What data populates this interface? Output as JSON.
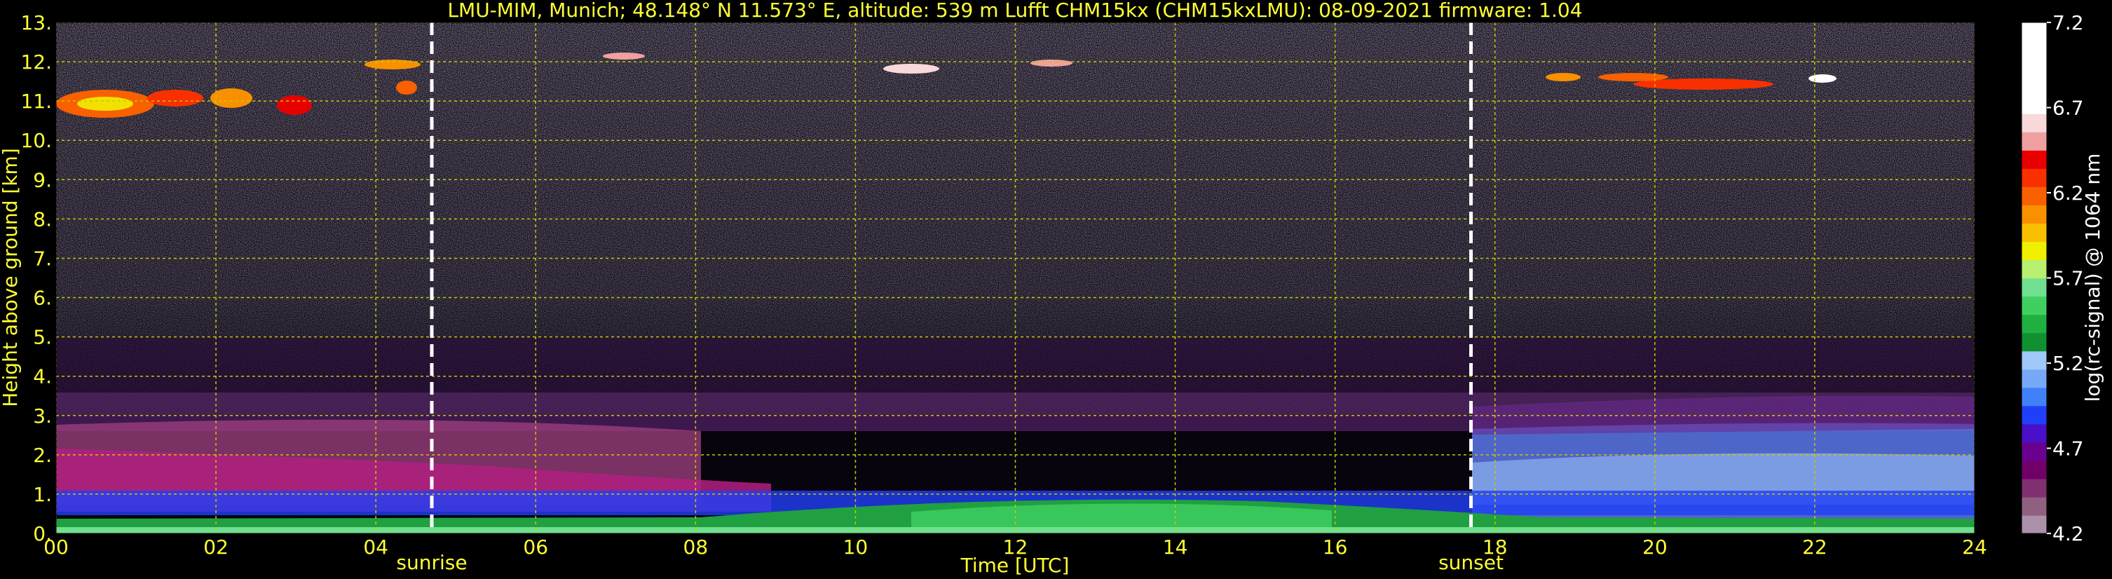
{
  "chart_data": {
    "type": "heatmap",
    "title": "LMU-MIM, Munich; 48.148° N 11.573° E, altitude: 539 m    Lufft CHM15kx (CHM15kxLMU): 08-09-2021    firmware: 1.04",
    "xlabel": "Time [UTC]",
    "ylabel": "Height above ground [km]",
    "xlim": [
      0,
      24
    ],
    "ylim": [
      0,
      13
    ],
    "x_ticks": [
      "00",
      "02",
      "04",
      "06",
      "08",
      "10",
      "12",
      "14",
      "16",
      "18",
      "20",
      "22",
      "24"
    ],
    "y_ticks": [
      "0.",
      "1.",
      "2.",
      "3.",
      "4.",
      "5.",
      "6.",
      "7.",
      "8.",
      "9.",
      "10.",
      "11.",
      "12.",
      "13."
    ],
    "grid": true,
    "vertical_markers": [
      {
        "label": "sunrise",
        "x": 4.7
      },
      {
        "label": "sunset",
        "x": 17.7
      }
    ],
    "colorbar": {
      "label": "log(rc-signal) @ 1064 nm",
      "ticks": [
        "4.2",
        "4.7",
        "5.2",
        "5.7",
        "6.2",
        "6.7",
        "7.2"
      ],
      "range": [
        4.2,
        7.2
      ],
      "colors": [
        "#aa90a8",
        "#906080",
        "#803070",
        "#700068",
        "#6a0090",
        "#4a10c8",
        "#2040f8",
        "#4080f8",
        "#78a8f8",
        "#a0c8f8",
        "#109030",
        "#20b040",
        "#40d060",
        "#70e090",
        "#b8f070",
        "#f0f000",
        "#f8c000",
        "#f89000",
        "#f86000",
        "#f83000",
        "#e80000",
        "#f0a0a0",
        "#f8d8d8",
        "#ffffff",
        "#ffffff",
        "#ffffff",
        "#ffffff",
        "#ffffff"
      ]
    }
  },
  "colors": {
    "axis_text": "#ffff33",
    "grid": "#c8c800",
    "marker": "#ffffff",
    "background": "#000000"
  }
}
